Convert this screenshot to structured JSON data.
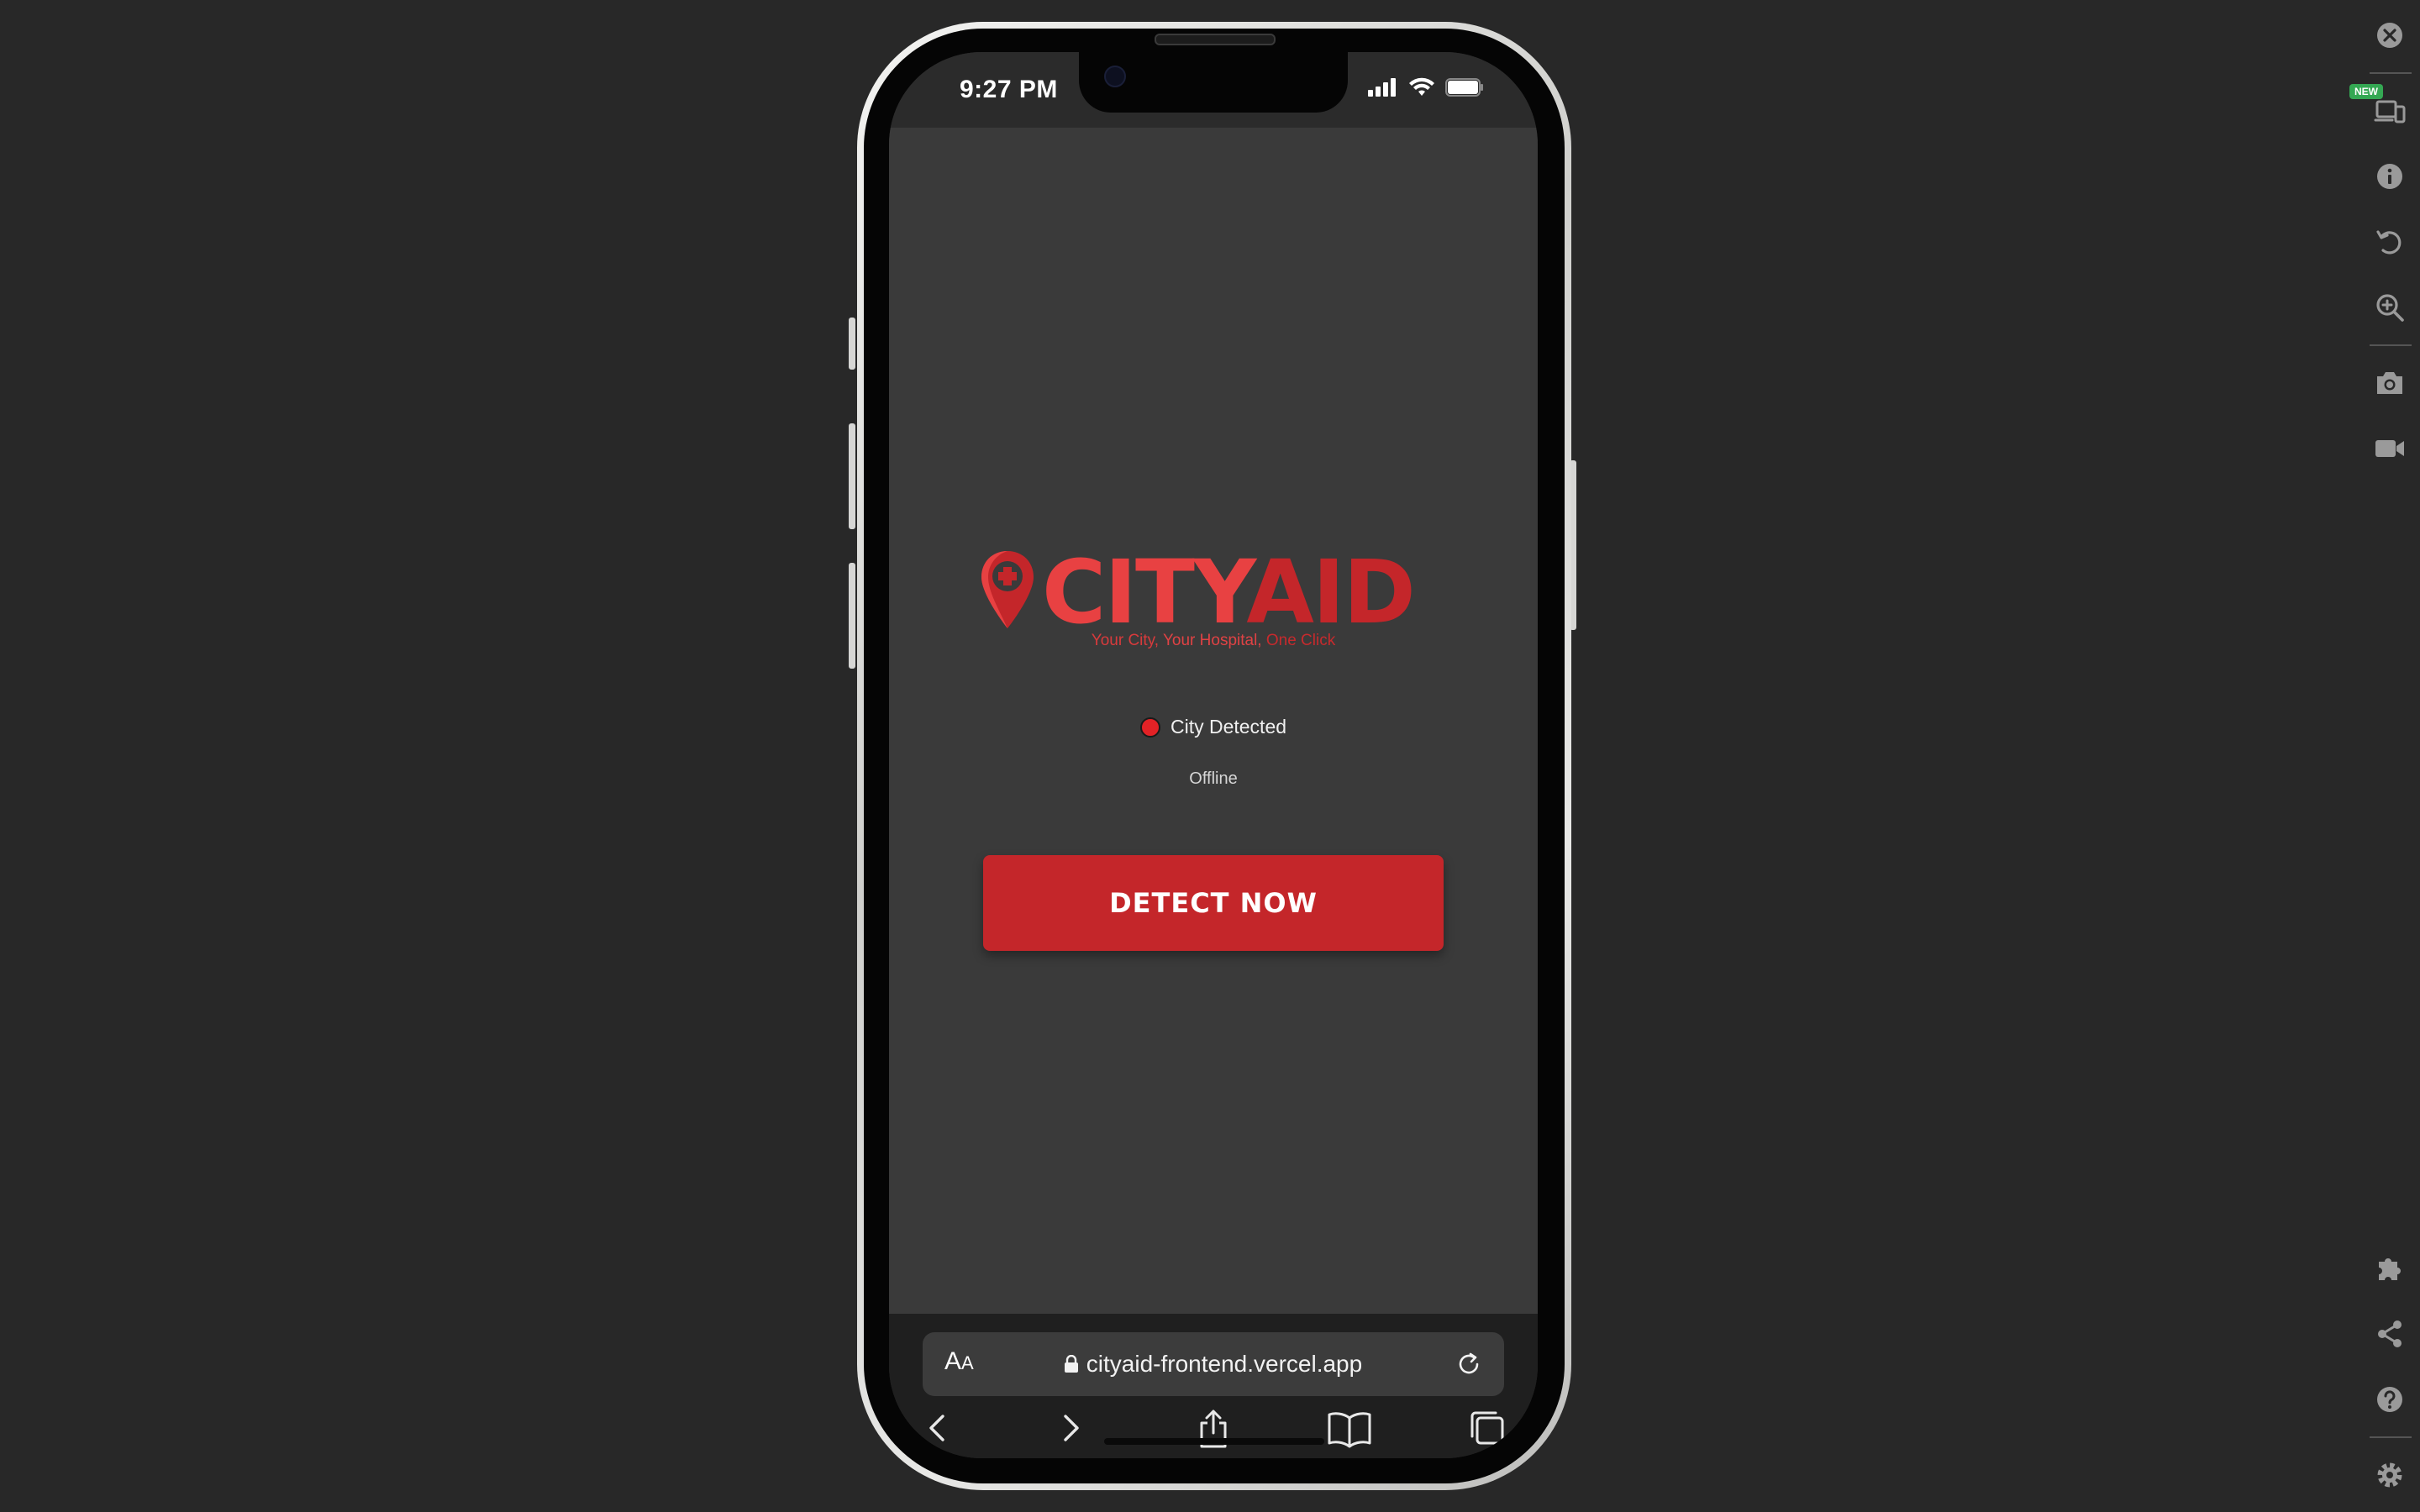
{
  "status_bar": {
    "time": "9:27 PM",
    "icons": [
      "cellular-signal-icon",
      "wifi-icon",
      "battery-icon"
    ]
  },
  "page": {
    "logo": {
      "part1": "CITY",
      "part2": "AID",
      "icon": "map-pin-medical-icon"
    },
    "tagline": {
      "part1": "Your City,",
      "part2": " Your Hospital,",
      "part3": " One Click"
    },
    "status_label": "City Detected",
    "status_dot_color": "#e32226",
    "connection_status": "Offline",
    "detect_button_label": "DETECT NOW"
  },
  "safari": {
    "text_size_label": "A",
    "text_size_label_small": "A",
    "url": "cityaid-frontend.vercel.app",
    "toolbar_icons": [
      "back-icon",
      "forward-icon",
      "share-icon",
      "bookmarks-icon",
      "tabs-icon"
    ]
  },
  "simulator_toolbar": {
    "new_badge": "NEW",
    "icons": [
      "close-icon",
      "device-icon",
      "info-icon",
      "rotate-icon",
      "zoom-icon",
      "camera-icon",
      "video-icon",
      "extension-icon",
      "share-icon",
      "help-icon",
      "settings-icon"
    ]
  },
  "colors": {
    "accent_red": "#c4262a",
    "logo_light_red": "#e84142",
    "background": "#282828",
    "screen_bg": "#3a3a3a"
  }
}
